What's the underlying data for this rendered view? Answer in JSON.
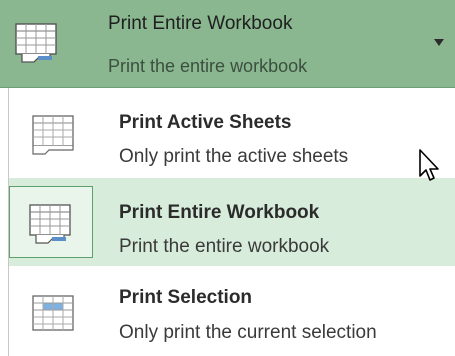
{
  "selector": {
    "title": "Print Entire Workbook",
    "subtitle": "Print the entire workbook",
    "icon": "workbook-sheets-icon",
    "arrow_icon": "dropdown-arrow-icon"
  },
  "menu": {
    "items": [
      {
        "title": "Print Active Sheets",
        "subtitle": "Only print the active sheets",
        "icon": "active-sheets-icon",
        "selected": false
      },
      {
        "title": "Print Entire Workbook",
        "subtitle": "Print the entire workbook",
        "icon": "workbook-sheets-icon",
        "selected": true
      },
      {
        "title": "Print Selection",
        "subtitle": "Only print the current selection",
        "icon": "selection-grid-icon",
        "selected": false
      }
    ]
  },
  "colors": {
    "header_bg": "#8ab790",
    "selected_bg": "#d7ecdb",
    "selected_border": "#5f9f6c",
    "selection_highlight": "#7fb0df"
  }
}
